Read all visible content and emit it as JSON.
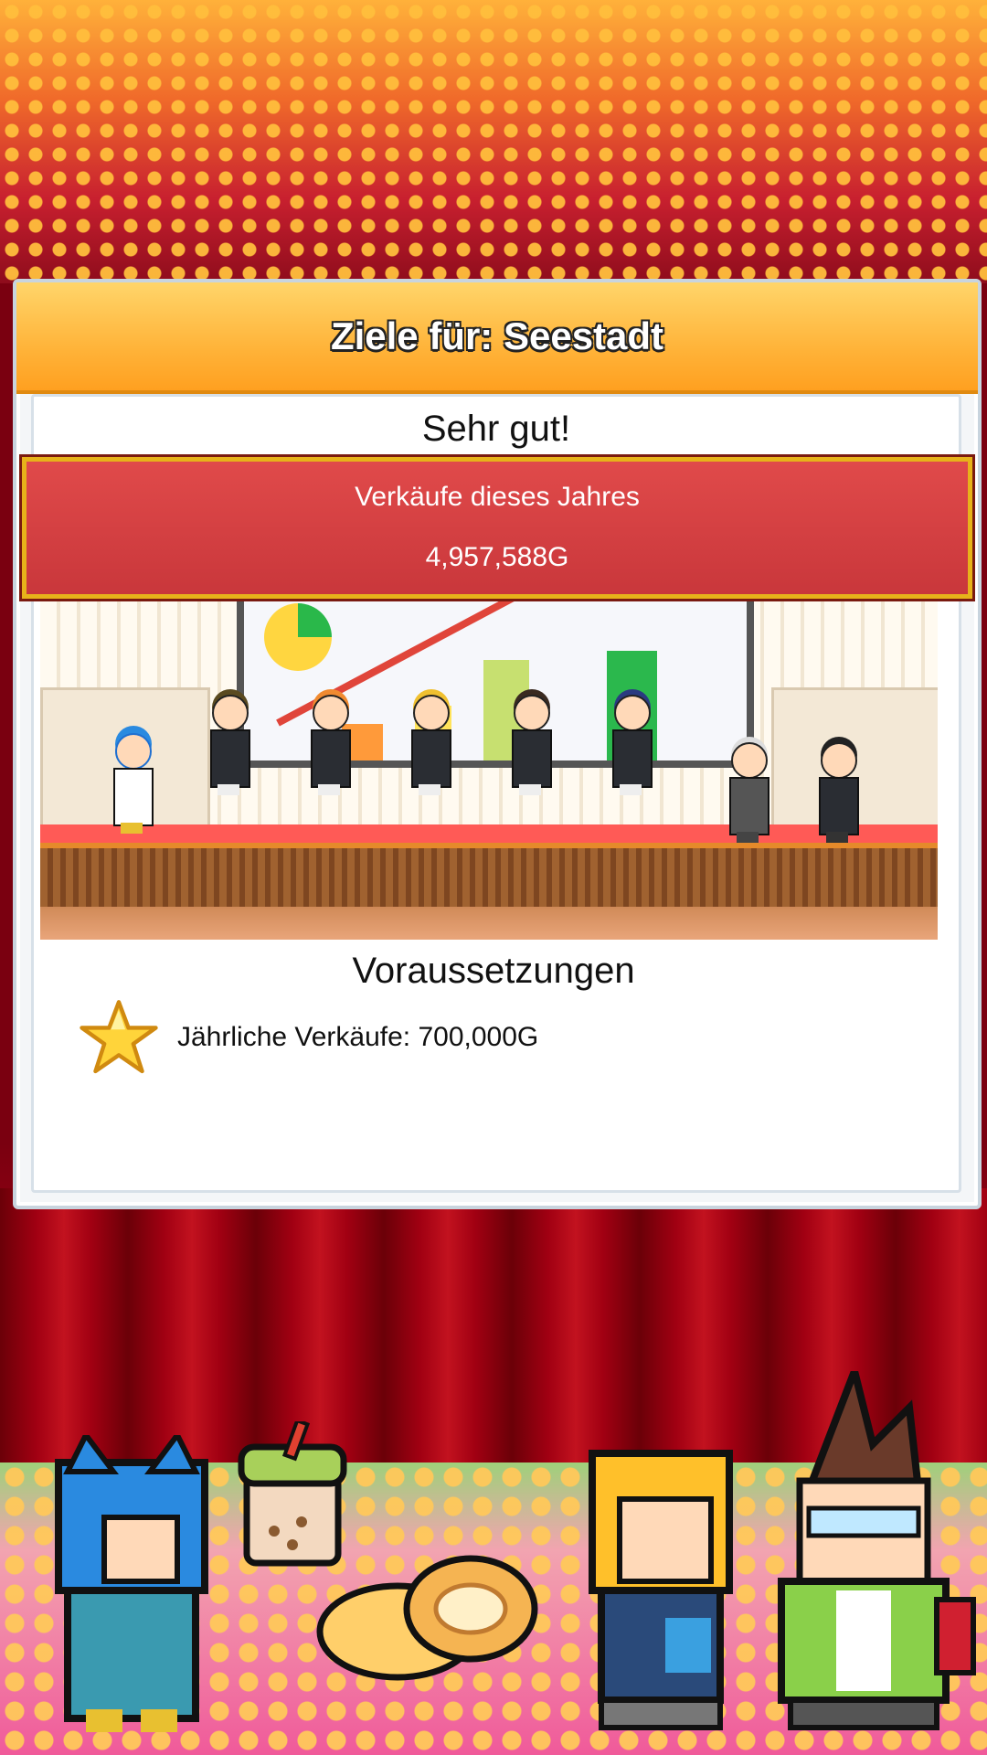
{
  "dialog": {
    "title": "Ziele für: Seestadt",
    "rating": "Sehr gut!",
    "sales_label": "Verkäufe dieses Jahres",
    "sales_value": "4,957,588G",
    "requirements_title": "Voraussetzungen",
    "requirements": [
      {
        "icon": "star-icon",
        "text": "Jährliche Verkäufe: 700,000G"
      }
    ]
  },
  "colors": {
    "header": "#ffb43a",
    "sales_box": "#c9373b",
    "sales_border": "#e7b21a",
    "curtain": "#a10012",
    "star": "#ffd43a"
  }
}
